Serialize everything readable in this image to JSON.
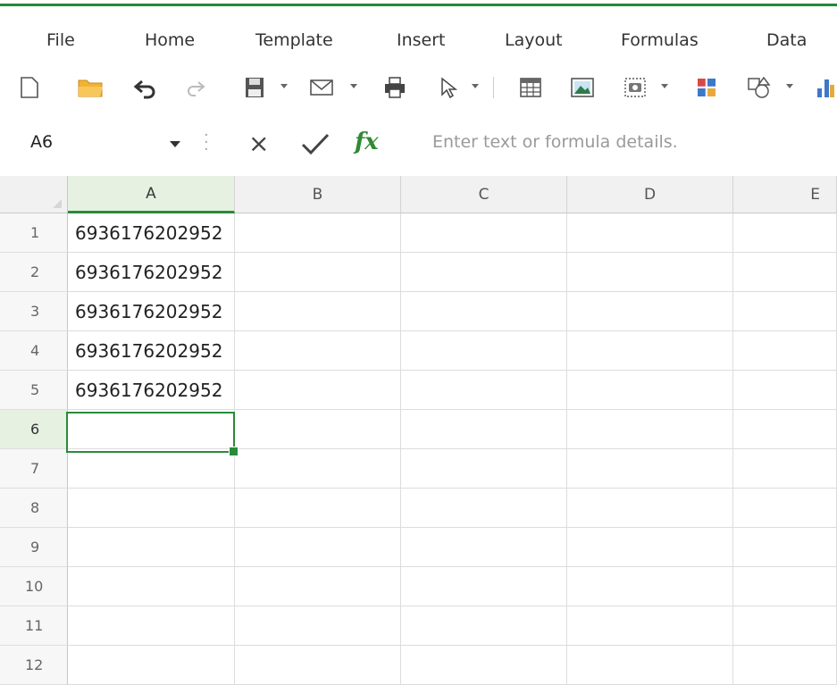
{
  "menu": [
    "File",
    "Home",
    "Template",
    "Insert",
    "Layout",
    "Formulas",
    "Data"
  ],
  "toolbar": {
    "icons": [
      "new-document-icon",
      "open-folder-icon",
      "undo-icon",
      "redo-icon",
      "save-icon",
      "email-icon",
      "print-icon",
      "select-pointer-icon",
      "table-icon",
      "image-icon",
      "screenshot-icon",
      "chart-grid-icon",
      "shapes-icon",
      "bar-chart-icon"
    ]
  },
  "formula_bar": {
    "name_box": "A6",
    "cancel_symbol": "×",
    "fx_label": "fx",
    "placeholder": "Enter text or formula details."
  },
  "grid": {
    "columns": [
      "A",
      "B",
      "C",
      "D",
      "E"
    ],
    "active_column": "A",
    "rows": [
      "1",
      "2",
      "3",
      "4",
      "5",
      "6",
      "7",
      "8",
      "9",
      "10",
      "11",
      "12"
    ],
    "active_row": "6",
    "column_a_values": [
      "6936176202952",
      "6936176202952",
      "6936176202952",
      "6936176202952",
      "6936176202952",
      "",
      "",
      "",
      "",
      "",
      "",
      ""
    ],
    "selected_cell": "A6"
  },
  "colors": {
    "accent": "#2a8a3b",
    "header_bg": "#f1f1f1",
    "active_header_bg": "#e6f1e2",
    "grid_line": "#dcdcdc"
  }
}
